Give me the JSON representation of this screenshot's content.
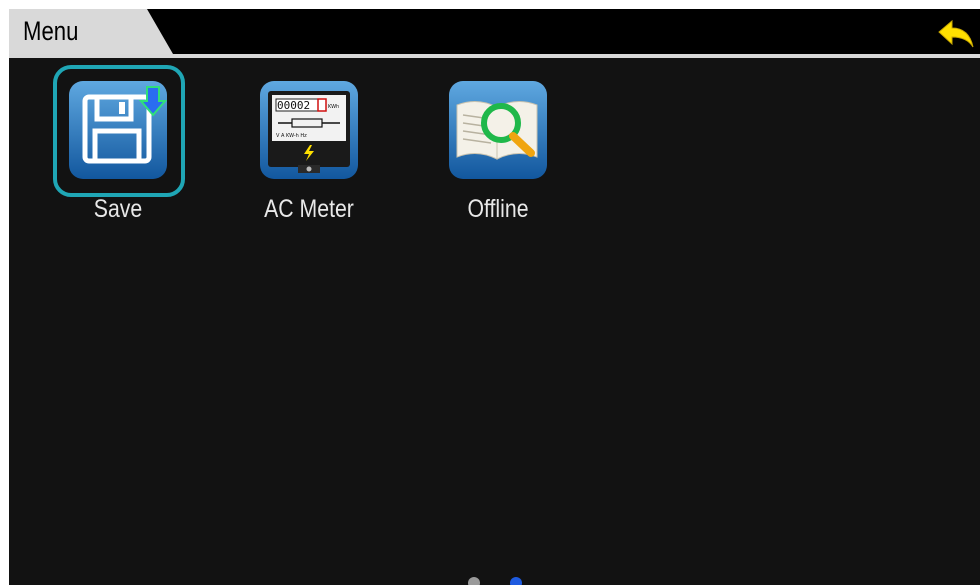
{
  "header": {
    "title": "Menu"
  },
  "apps": [
    {
      "label": "Save",
      "icon": "floppy-save-icon",
      "selected": true
    },
    {
      "label": "AC Meter",
      "icon": "ac-meter-icon",
      "selected": false
    },
    {
      "label": "Offline",
      "icon": "offline-book-search-icon",
      "selected": false
    }
  ],
  "meter": {
    "digits": "00002",
    "unit": "KWh",
    "scale": "V A KW-h Hz"
  },
  "pagination": {
    "pages": 2,
    "active": 2
  },
  "colors": {
    "background": "#121212",
    "header": "#000000",
    "tab": "#d9d9d9",
    "selection": "#1fa6b5",
    "back_arrow": "#ffe000",
    "dot_active": "#1e5be0",
    "dot_inactive": "#9a9a9a"
  }
}
